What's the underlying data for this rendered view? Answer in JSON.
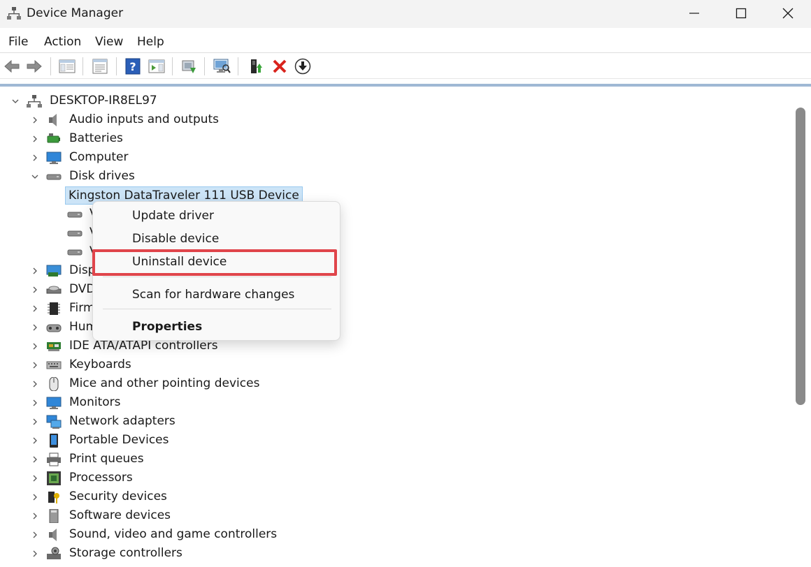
{
  "window": {
    "title": "Device Manager",
    "controls": [
      "minimize",
      "maximize",
      "close"
    ]
  },
  "menubar": {
    "items": [
      "File",
      "Action",
      "View",
      "Help"
    ]
  },
  "toolbar": {
    "buttons": [
      "back-icon",
      "forward-icon",
      "show-hide-console-tree-icon",
      "properties-icon",
      "help-icon",
      "action-pane-icon",
      "update-driver-icon",
      "scan-hardware-icon",
      "enable-device-icon",
      "uninstall-icon",
      "download-icon"
    ]
  },
  "tree": {
    "root": "DESKTOP-IR8EL97",
    "categories": [
      {
        "label": "Audio inputs and outputs",
        "icon": "speaker-icon",
        "expanded": false
      },
      {
        "label": "Batteries",
        "icon": "battery-icon",
        "expanded": false
      },
      {
        "label": "Computer",
        "icon": "monitor-icon",
        "expanded": false
      },
      {
        "label": "Disk drives",
        "icon": "disk-drive-icon",
        "expanded": true
      },
      {
        "label": "Disp",
        "icon": "display-adapter-icon",
        "expanded": false
      },
      {
        "label": "DVD",
        "icon": "dvd-drive-icon",
        "expanded": false
      },
      {
        "label": "Firm",
        "icon": "firmware-icon",
        "expanded": false
      },
      {
        "label": "Hum",
        "icon": "human-interface-icon",
        "expanded": false
      },
      {
        "label": "IDE ATA/ATAPI controllers",
        "icon": "ide-controller-icon",
        "expanded": false
      },
      {
        "label": "Keyboards",
        "icon": "keyboard-icon",
        "expanded": false
      },
      {
        "label": "Mice and other pointing devices",
        "icon": "mouse-icon",
        "expanded": false
      },
      {
        "label": "Monitors",
        "icon": "monitor-icon",
        "expanded": false
      },
      {
        "label": "Network adapters",
        "icon": "network-icon",
        "expanded": false
      },
      {
        "label": "Portable Devices",
        "icon": "portable-device-icon",
        "expanded": false
      },
      {
        "label": "Print queues",
        "icon": "printer-icon",
        "expanded": false
      },
      {
        "label": "Processors",
        "icon": "processor-icon",
        "expanded": false
      },
      {
        "label": "Security devices",
        "icon": "security-key-icon",
        "expanded": false
      },
      {
        "label": "Software devices",
        "icon": "software-device-icon",
        "expanded": false
      },
      {
        "label": "Sound, video and game controllers",
        "icon": "speaker-icon",
        "expanded": false
      },
      {
        "label": "Storage controllers",
        "icon": "storage-controller-icon",
        "expanded": false
      }
    ],
    "disk_children": [
      {
        "label": "Kingston DataTraveler 111 USB Device",
        "selected": true
      },
      {
        "label": "V",
        "selected": false
      },
      {
        "label": "V",
        "selected": false
      },
      {
        "label": "V",
        "selected": false
      }
    ]
  },
  "context_menu": {
    "items": [
      {
        "label": "Update driver",
        "bold": false
      },
      {
        "label": "Disable device",
        "bold": false
      },
      {
        "label": "Uninstall device",
        "bold": false,
        "highlighted": true
      },
      {
        "label": "Scan for hardware changes",
        "bold": false
      },
      {
        "label": "Properties",
        "bold": true
      }
    ]
  },
  "colors": {
    "selection_bg": "#cce4f7",
    "highlight_border": "#e0454b",
    "tree_top_border": "#9fb8d4"
  }
}
